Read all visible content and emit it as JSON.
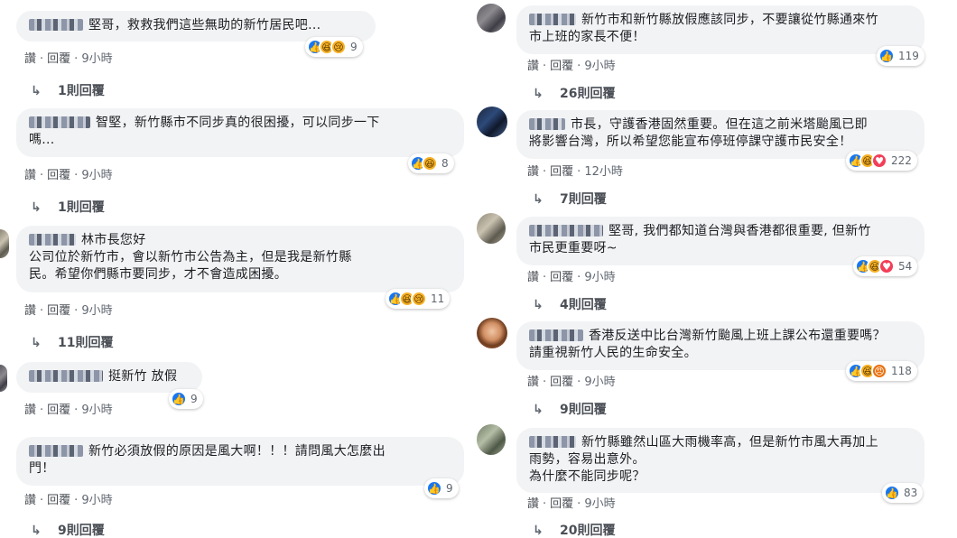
{
  "left": [
    {
      "text": "堅哥，救救我們這些無助的新竹居民吧...",
      "actions": {
        "like": "讚",
        "reply": "回覆",
        "time": "9小時"
      },
      "reaction_count": "9",
      "reactions": [
        "like",
        "haha",
        "sad"
      ],
      "replies": "1則回覆"
    },
    {
      "text": "智堅，新竹縣市不同步真的很困擾，可以同步一下\n嗎...",
      "actions": {
        "like": "讚",
        "reply": "回覆",
        "time": "9小時"
      },
      "reaction_count": "8",
      "reactions": [
        "like",
        "haha"
      ],
      "replies": "1則回覆"
    },
    {
      "text": "林市長您好\n公司位於新竹市，會以新竹市公告為主，但是我是新竹縣\n民。希望你們縣市要同步，才不會造成困擾。",
      "actions": {
        "like": "讚",
        "reply": "回覆",
        "time": "9小時"
      },
      "reaction_count": "11",
      "reactions": [
        "like",
        "haha",
        "sad"
      ],
      "replies": "11則回覆"
    },
    {
      "text": "挺新竹 放假",
      "actions": {
        "like": "讚",
        "reply": "回覆",
        "time": "9小時"
      },
      "reaction_count": "9",
      "reactions": [
        "like"
      ],
      "replies": ""
    },
    {
      "text": "新竹必須放假的原因是風大啊！！！請問風大怎麼出\n門！",
      "actions": {
        "like": "讚",
        "reply": "回覆",
        "time": "9小時"
      },
      "reaction_count": "9",
      "reactions": [
        "like"
      ],
      "replies": "9則回覆"
    }
  ],
  "right": [
    {
      "text": "新竹市和新竹縣放假應該同步，不要讓從竹縣通來竹\n市上班的家長不便！",
      "actions": {
        "like": "讚",
        "reply": "回覆",
        "time": "9小時"
      },
      "reaction_count": "119",
      "reactions": [
        "like"
      ],
      "replies": "26則回覆"
    },
    {
      "text": "市長，守護香港固然重要。但在這之前米塔颱風已即\n將影響台灣，所以希望您能宣布停班停課守護市民安全！",
      "actions": {
        "like": "讚",
        "reply": "回覆",
        "time": "12小時"
      },
      "reaction_count": "222",
      "reactions": [
        "like",
        "haha",
        "love"
      ],
      "replies": "7則回覆"
    },
    {
      "text": "堅哥, 我們都知道台灣與香港都很重要, 但新竹\n市民更重要呀~",
      "actions": {
        "like": "讚",
        "reply": "回覆",
        "time": "9小時"
      },
      "reaction_count": "54",
      "reactions": [
        "like",
        "haha",
        "love"
      ],
      "replies": "4則回覆"
    },
    {
      "text": "香港反送中比台灣新竹颱風上班上課公布還重要嗎？\n請重視新竹人民的生命安全。",
      "actions": {
        "like": "讚",
        "reply": "回覆",
        "time": "9小時"
      },
      "reaction_count": "118",
      "reactions": [
        "like",
        "haha",
        "angry"
      ],
      "replies": "9則回覆"
    },
    {
      "text": "新竹縣雖然山區大雨機率高，但是新竹市風大再加上\n雨勢，容易出意外。\n為什麼不能同步呢？",
      "actions": {
        "like": "讚",
        "reply": "回覆",
        "time": "9小時"
      },
      "reaction_count": "83",
      "reactions": [
        "like"
      ],
      "replies": "20則回覆"
    }
  ],
  "icons": {
    "like": "thumbs-up-icon",
    "haha": "laughing-face-icon",
    "sad": "crying-face-icon",
    "love": "heart-icon",
    "angry": "angry-face-icon",
    "reply_arrow": "reply-arrow-icon"
  },
  "colors": {
    "bubble": "#f2f3f5",
    "link": "#4b4f56",
    "meta": "#606770",
    "like_blue": "#1877f2"
  }
}
